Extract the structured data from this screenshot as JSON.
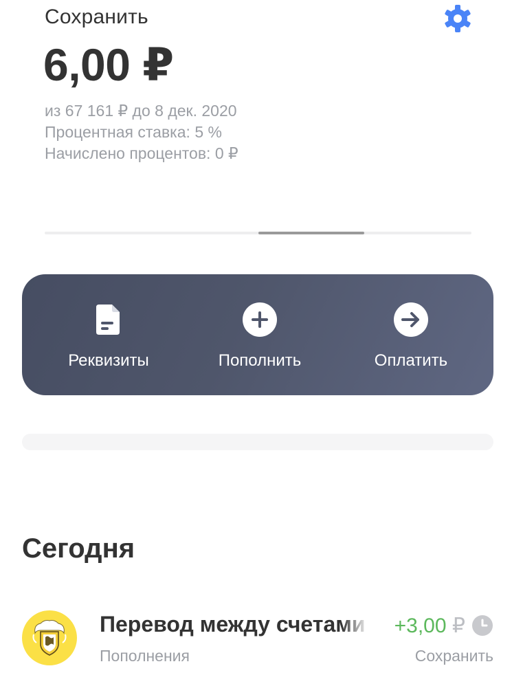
{
  "account": {
    "title": "Сохранить",
    "balance": "6,00 ₽",
    "goal_line": "из 67 161 ₽ до 8 дек. 2020",
    "rate_line": "Процентная ставка: 5 %",
    "interest_line": "Начислено процентов: 0 ₽",
    "settings_icon": "gear-icon",
    "accent_color": "#4a84f7"
  },
  "carousel": {
    "position_fraction": 0.5
  },
  "actions": [
    {
      "label": "Реквизиты",
      "icon": "document-icon"
    },
    {
      "label": "Пополнить",
      "icon": "plus-circle-icon"
    },
    {
      "label": "Оплатить",
      "icon": "arrow-right-circle-icon"
    }
  ],
  "operations": {
    "section_title": "Сегодня",
    "items": [
      {
        "title": "Перевод между счетами",
        "category": "Пополнения",
        "amount_value": "+3,00",
        "amount_currency": "₽",
        "account": "Сохранить",
        "status_icon": "clock-icon",
        "amount_color": "#5cb85c"
      }
    ]
  }
}
